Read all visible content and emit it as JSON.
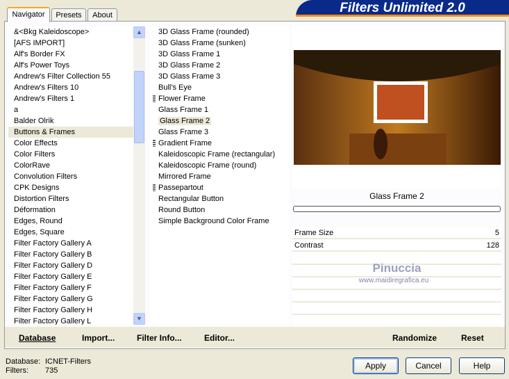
{
  "title": "Filters Unlimited 2.0",
  "tabs": [
    "Navigator",
    "Presets",
    "About"
  ],
  "categories": [
    "&<Bkg Kaleidoscope>",
    "[AFS IMPORT]",
    "Alf's Border FX",
    "Alf's Power Toys",
    "Andrew's Filter Collection 55",
    "Andrew's Filters 10",
    "Andrew's Filters 1",
    "a",
    "Balder Olrik",
    "Buttons & Frames",
    "Color Effects",
    "Color Filters",
    "ColorRave",
    "Convolution Filters",
    "CPK Designs",
    "Distortion Filters",
    "Déformation",
    "Edges, Round",
    "Edges, Square",
    "Filter Factory Gallery A",
    "Filter Factory Gallery B",
    "Filter Factory Gallery D",
    "Filter Factory Gallery E",
    "Filter Factory Gallery F",
    "Filter Factory Gallery G",
    "Filter Factory Gallery H",
    "Filter Factory Gallery L"
  ],
  "selected_category": "Buttons & Frames",
  "filters": [
    {
      "label": "3D Glass Frame (rounded)",
      "grip": false
    },
    {
      "label": "3D Glass Frame (sunken)",
      "grip": false
    },
    {
      "label": "3D Glass Frame 1",
      "grip": false
    },
    {
      "label": "3D Glass Frame 2",
      "grip": false
    },
    {
      "label": "3D Glass Frame 3",
      "grip": false
    },
    {
      "label": "Bull's Eye",
      "grip": false
    },
    {
      "label": "Flower Frame",
      "grip": true
    },
    {
      "label": "Glass Frame 1",
      "grip": false
    },
    {
      "label": "Glass Frame 2",
      "grip": false
    },
    {
      "label": "Glass Frame 3",
      "grip": false
    },
    {
      "label": "Gradient Frame",
      "grip": true
    },
    {
      "label": "Kaleidoscopic Frame (rectangular)",
      "grip": false
    },
    {
      "label": "Kaleidoscopic Frame (round)",
      "grip": false
    },
    {
      "label": "Mirrored Frame",
      "grip": false
    },
    {
      "label": "Passepartout",
      "grip": true
    },
    {
      "label": "Rectangular Button",
      "grip": false
    },
    {
      "label": "Round Button",
      "grip": false
    },
    {
      "label": "Simple Background Color Frame",
      "grip": false
    }
  ],
  "selected_filter": "Glass Frame 2",
  "filter_name": "Glass Frame 2",
  "params": [
    {
      "label": "Frame Size",
      "value": "5"
    },
    {
      "label": "Contrast",
      "value": "128"
    }
  ],
  "watermark": {
    "name": "Pinuccia",
    "url": "www.maidiregrafica.eu"
  },
  "bottom_bar": {
    "database": "Database",
    "import": "Import...",
    "filter_info": "Filter Info...",
    "editor": "Editor...",
    "randomize": "Randomize",
    "reset": "Reset"
  },
  "status": {
    "database_label": "Database:",
    "database_value": "ICNET-Filters",
    "filters_label": "Filters:",
    "filters_value": "735"
  },
  "buttons": {
    "apply": "Apply",
    "cancel": "Cancel",
    "help": "Help"
  }
}
